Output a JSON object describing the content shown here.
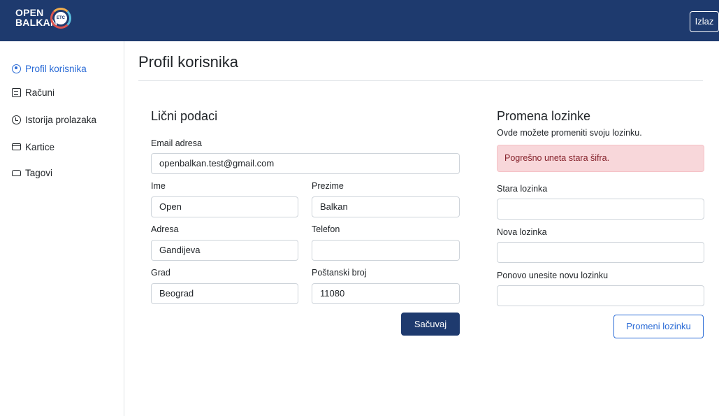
{
  "header": {
    "logo_line1": "OPEN",
    "logo_line2": "BALKAN",
    "logo_badge": "ETC",
    "logout_label": "Izlaz"
  },
  "sidebar": {
    "items": [
      {
        "label": "Profil korisnika",
        "icon": "user-circle-icon",
        "active": true
      },
      {
        "label": "Računi",
        "icon": "document-icon",
        "active": false
      },
      {
        "label": "Istorija prolazaka",
        "icon": "clock-icon",
        "active": false
      },
      {
        "label": "Kartice",
        "icon": "card-icon",
        "active": false
      },
      {
        "label": "Tagovi",
        "icon": "tag-icon",
        "active": false
      }
    ]
  },
  "page": {
    "title": "Profil korisnika"
  },
  "personal": {
    "title": "Lični podaci",
    "email_label": "Email adresa",
    "email_value": "openbalkan.test@gmail.com",
    "first_name_label": "Ime",
    "first_name_value": "Open",
    "last_name_label": "Prezime",
    "last_name_value": "Balkan",
    "address_label": "Adresa",
    "address_value": "Gandijeva",
    "phone_label": "Telefon",
    "phone_value": "",
    "city_label": "Grad",
    "city_value": "Beograd",
    "zip_label": "Poštanski broj",
    "zip_value": "11080",
    "save_label": "Sačuvaj"
  },
  "password": {
    "title": "Promena lozinke",
    "subtitle": "Ovde možete promeniti svoju lozinku.",
    "error": "Pogrešno uneta stara šifra.",
    "old_label": "Stara lozinka",
    "new_label": "Nova lozinka",
    "repeat_label": "Ponovo unesite novu lozinku",
    "submit_label": "Promeni lozinku"
  },
  "colors": {
    "brand": "#1e3a6e",
    "accent": "#2a6bd6",
    "alert_bg": "#f8d7da",
    "alert_text": "#842029"
  }
}
